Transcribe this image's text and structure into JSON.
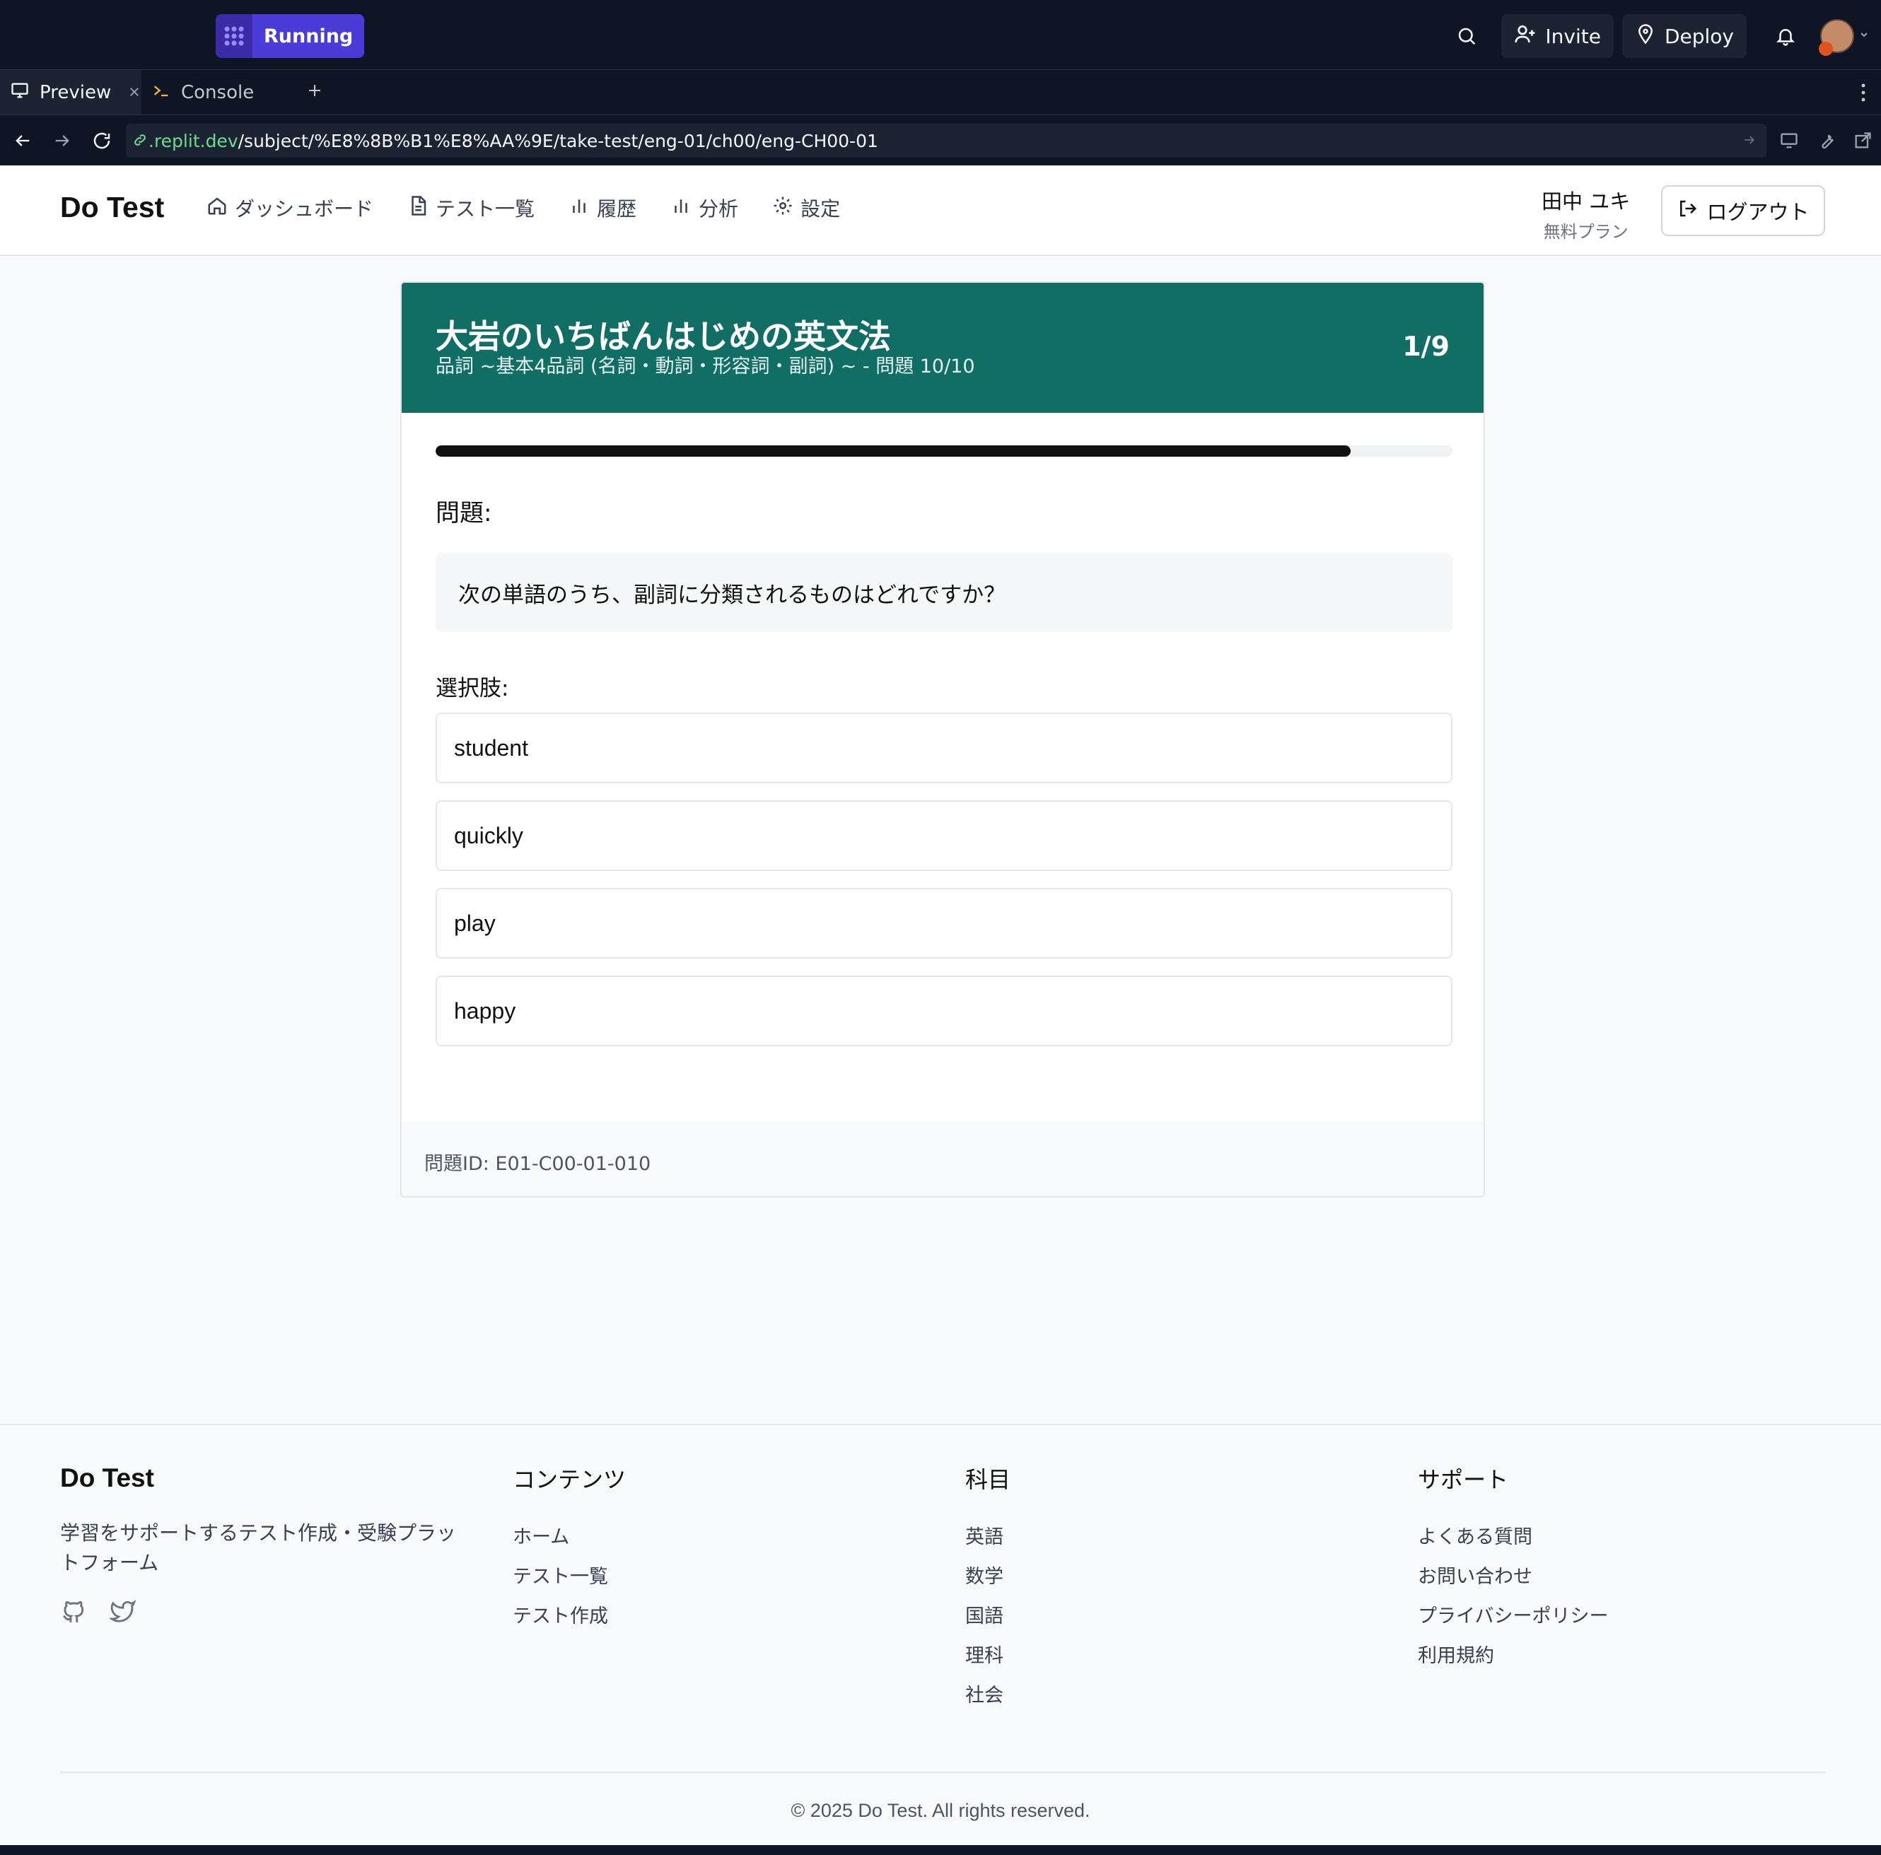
{
  "replit": {
    "status": "Running",
    "invite": "Invite",
    "deploy": "Deploy",
    "tabs": [
      {
        "label": "Preview"
      },
      {
        "label": "Console"
      }
    ],
    "url_host": ".replit.dev",
    "url_path": "/subject/%E8%8B%B1%E8%AA%9E/take-test/eng-01/ch00/eng-CH00-01"
  },
  "header": {
    "brand": "Do Test",
    "nav": [
      {
        "label": "ダッシュボード",
        "icon": "home-icon"
      },
      {
        "label": "テスト一覧",
        "icon": "document-icon"
      },
      {
        "label": "履歴",
        "icon": "bar-chart-icon"
      },
      {
        "label": "分析",
        "icon": "bar-chart-icon"
      },
      {
        "label": "設定",
        "icon": "gear-icon"
      }
    ],
    "user_name": "田中 ユキ",
    "user_plan": "無料プラン",
    "logout": "ログアウト"
  },
  "test": {
    "title": "大岩のいちばんはじめの英文法",
    "subtitle": "品詞 ~基本4品詞 (名詞・動詞・形容詞・副詞) ~ - 問題 10/10",
    "counter": "1/9",
    "progress": 0.9,
    "question_label": "問題:",
    "question": "次の単語のうち、副詞に分類されるものはどれですか？",
    "choices_label": "選択肢:",
    "choices": [
      "student",
      "quickly",
      "play",
      "happy"
    ],
    "question_id": "問題ID: E01-C00-01-010"
  },
  "footer": {
    "brand": "Do Test",
    "description": "学習をサポートするテスト作成・受験プラットフォーム",
    "columns": [
      {
        "title": "コンテンツ",
        "links": [
          "ホーム",
          "テスト一覧",
          "テスト作成"
        ]
      },
      {
        "title": "科目",
        "links": [
          "英語",
          "数学",
          "国語",
          "理科",
          "社会"
        ]
      },
      {
        "title": "サポート",
        "links": [
          "よくある質問",
          "お問い合わせ",
          "プライバシーポリシー",
          "利用規約"
        ]
      }
    ],
    "copyright": "© 2025 Do Test. All rights reserved."
  },
  "colors": {
    "card_header": "#116e64",
    "replit_bg": "#0e1525",
    "running": "#4b3cd8"
  }
}
